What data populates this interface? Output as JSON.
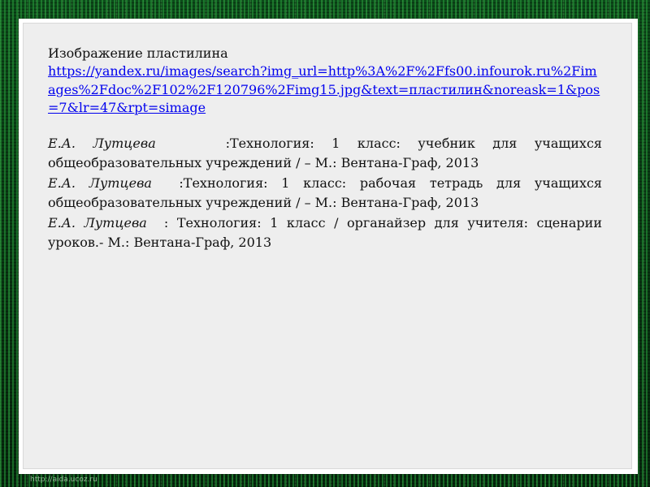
{
  "slide": {
    "heading": "Изображение пластилина",
    "link": {
      "url": "https://yandex.ru/images/search?img_url=http%3A%2F%2Ffs00.infourok.ru%2Fimages%2Fdoc%2F102%2F120796%2Fimg15.jpg&text=пластилин&noreask=1&pos=7&lr=47&rpt=simage"
    },
    "references": [
      {
        "author": "Е.А. Лутцева",
        "sep": "    :",
        "text": "Технология: 1 класс: учебник для учащихся общеобразовательных учреждений / – М.: Вентана-Граф, 2013"
      },
      {
        "author": "Е.А. Лутцева",
        "sep": "  :",
        "text": "Технология: 1 класс:   рабочая тетрадь для учащихся общеобразовательных учреждений / – М.: Вентана-Граф, 2013"
      },
      {
        "author": "Е.А. Лутцева",
        "sep": "  : ",
        "text": "Технология: 1 класс /   органайзер для учителя: сценарии уроков.- М.: Вентана-Граф, 2013"
      }
    ]
  },
  "footer": {
    "watermark": "http://aida.ucoz.ru"
  },
  "colors": {
    "background": "#0b3a14",
    "link": "#0000ee",
    "panel": "#eeeeee"
  }
}
